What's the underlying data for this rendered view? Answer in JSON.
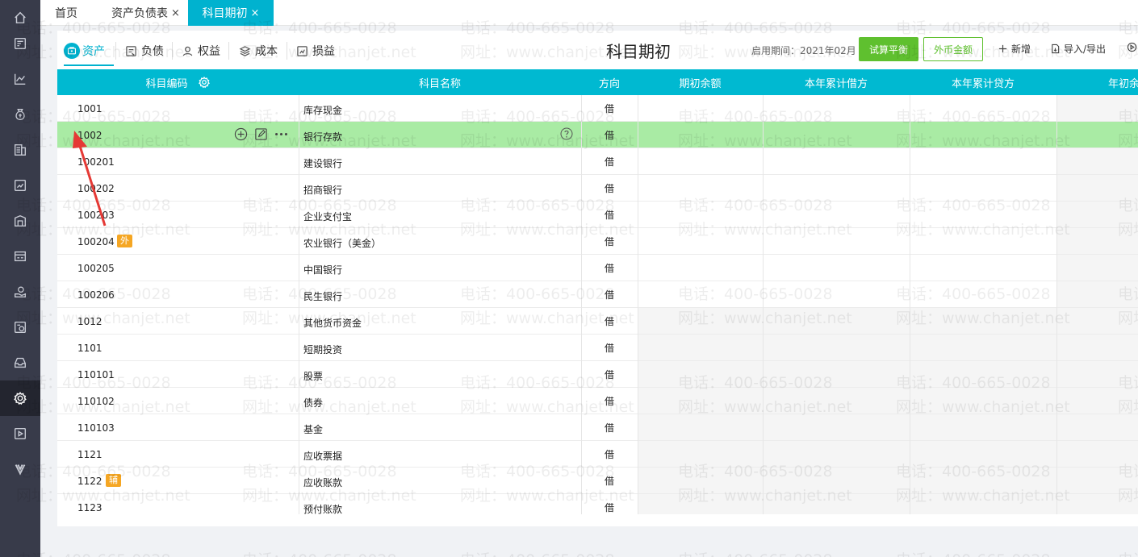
{
  "top_tabs": [
    {
      "label": "首页",
      "closable": false,
      "active": false
    },
    {
      "label": "资产负债表",
      "closable": true,
      "active": false
    },
    {
      "label": "科目期初",
      "closable": true,
      "active": true
    }
  ],
  "close_glyph": "×",
  "sidebar_icons": [
    "home-icon",
    "voucher-icon",
    "chart-icon",
    "money-bag-icon",
    "ledger-icon",
    "report-icon",
    "warehouse-icon",
    "invoice-icon",
    "hand-coin-icon",
    "tax-icon",
    "inbox-icon",
    "settings-icon",
    "video-icon",
    "vip-icon"
  ],
  "categories": [
    {
      "label": "资产",
      "icon": "asset-icon",
      "active": true
    },
    {
      "label": "负债",
      "icon": "liability-icon",
      "active": false
    },
    {
      "label": "权益",
      "icon": "equity-icon",
      "active": false
    },
    {
      "label": "成本",
      "icon": "cost-icon",
      "active": false
    },
    {
      "label": "损益",
      "icon": "profit-loss-icon",
      "active": false
    }
  ],
  "header": {
    "title": "科目期初",
    "period_label": "启用期间：2021年02月",
    "trial_balance_btn": "试算平衡",
    "foreign_currency_btn": "外币金额",
    "add_btn": "新增",
    "import_export_btn": "导入/导出"
  },
  "columns": [
    "科目编码",
    "科目名称",
    "方向",
    "期初余额",
    "本年累计借方",
    "本年累计贷方",
    "年初余"
  ],
  "rows": [
    {
      "code": "1001",
      "name": "库存现金",
      "dir": "借",
      "badge": ""
    },
    {
      "code": "1002",
      "name": "银行存款",
      "dir": "借",
      "badge": "",
      "selected": true
    },
    {
      "code": "100201",
      "name": "建设银行",
      "dir": "借",
      "badge": ""
    },
    {
      "code": "100202",
      "name": "招商银行",
      "dir": "借",
      "badge": ""
    },
    {
      "code": "100203",
      "name": "企业支付宝",
      "dir": "借",
      "badge": ""
    },
    {
      "code": "100204",
      "name": "农业银行（美金）",
      "dir": "借",
      "badge": "外"
    },
    {
      "code": "100205",
      "name": "中国银行",
      "dir": "借",
      "badge": ""
    },
    {
      "code": "100206",
      "name": "民生银行",
      "dir": "借",
      "badge": ""
    },
    {
      "code": "1012",
      "name": "其他货币资金",
      "dir": "借",
      "badge": ""
    },
    {
      "code": "1101",
      "name": "短期投资",
      "dir": "借",
      "badge": ""
    },
    {
      "code": "110101",
      "name": "股票",
      "dir": "借",
      "badge": ""
    },
    {
      "code": "110102",
      "name": "债券",
      "dir": "借",
      "badge": ""
    },
    {
      "code": "110103",
      "name": "基金",
      "dir": "借",
      "badge": ""
    },
    {
      "code": "1121",
      "name": "应收票据",
      "dir": "借",
      "badge": ""
    },
    {
      "code": "1122",
      "name": "应收账款",
      "dir": "借",
      "badge": "辅"
    },
    {
      "code": "1123",
      "name": "预付账款",
      "dir": "借",
      "badge": ""
    }
  ],
  "watermark": {
    "phone": "电话：400-665-0028",
    "site": "网址：www.chanjet.net"
  },
  "colors": {
    "accent": "#00b2cf",
    "header_bg": "#00b9d1",
    "selected_row": "#a9eba4",
    "green_btn": "#5fc02f",
    "badge": "#f5a623",
    "sidebar": "#383b4a",
    "annotation_arrow": "#e53935"
  }
}
